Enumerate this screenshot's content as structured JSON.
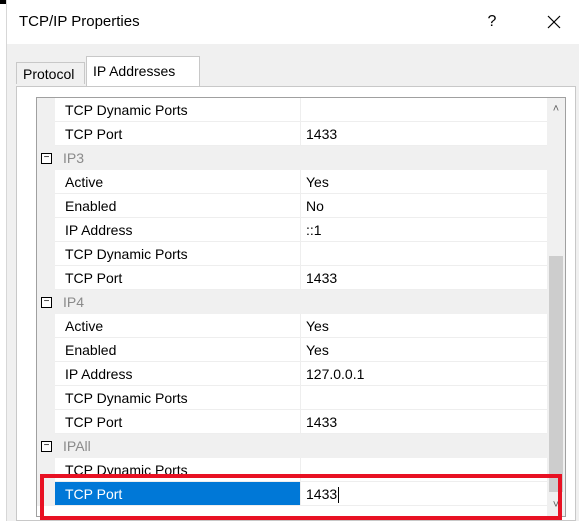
{
  "window": {
    "title": "TCP/IP Properties",
    "help_label": "?",
    "close_label": "✕"
  },
  "tabs": [
    {
      "label": "Protocol",
      "active": false
    },
    {
      "label": "IP Addresses",
      "active": true
    }
  ],
  "grid": {
    "rows": [
      {
        "kind": "prop",
        "name": "TCP Dynamic Ports",
        "value": ""
      },
      {
        "kind": "prop",
        "name": "TCP Port",
        "value": "1433"
      },
      {
        "kind": "cat",
        "name": "IP3",
        "toggle": "⊟"
      },
      {
        "kind": "prop",
        "name": "Active",
        "value": "Yes"
      },
      {
        "kind": "prop",
        "name": "Enabled",
        "value": "No"
      },
      {
        "kind": "prop",
        "name": "IP Address",
        "value": "::1"
      },
      {
        "kind": "prop",
        "name": "TCP Dynamic Ports",
        "value": ""
      },
      {
        "kind": "prop",
        "name": "TCP Port",
        "value": "1433"
      },
      {
        "kind": "cat",
        "name": "IP4",
        "toggle": "⊟"
      },
      {
        "kind": "prop",
        "name": "Active",
        "value": "Yes"
      },
      {
        "kind": "prop",
        "name": "Enabled",
        "value": "Yes"
      },
      {
        "kind": "prop",
        "name": "IP Address",
        "value": "127.0.0.1"
      },
      {
        "kind": "prop",
        "name": "TCP Dynamic Ports",
        "value": ""
      },
      {
        "kind": "prop",
        "name": "TCP Port",
        "value": "1433"
      },
      {
        "kind": "cat",
        "name": "IPAll",
        "toggle": "⊟"
      },
      {
        "kind": "prop",
        "name": "TCP Dynamic Ports",
        "value": ""
      },
      {
        "kind": "prop",
        "name": "TCP Port",
        "value": "1433",
        "selected": true
      }
    ],
    "scroll_up": "˄",
    "scroll_down": "˅"
  },
  "colors": {
    "selection": "#0078d7",
    "highlight_box": "#e81123"
  }
}
